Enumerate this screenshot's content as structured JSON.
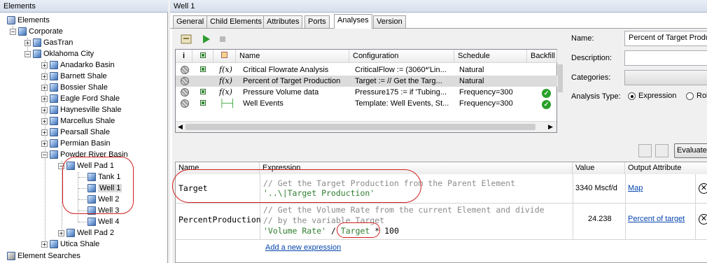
{
  "left": {
    "title": "Elements",
    "tree": [
      {
        "label": "Elements"
      },
      {
        "label": "Corporate"
      },
      {
        "label": "GasTran"
      },
      {
        "label": "Oklahoma City"
      },
      {
        "label": "Anadarko Basin"
      },
      {
        "label": "Barnett Shale"
      },
      {
        "label": "Bossier Shale"
      },
      {
        "label": "Eagle Ford Shale"
      },
      {
        "label": "Haynesville Shale"
      },
      {
        "label": "Marcellus Shale"
      },
      {
        "label": "Pearsall Shale"
      },
      {
        "label": "Permian Basin"
      },
      {
        "label": "Powder River Basin"
      },
      {
        "label": "Well Pad 1"
      },
      {
        "label": "Tank 1"
      },
      {
        "label": "Well 1"
      },
      {
        "label": "Well 2"
      },
      {
        "label": "Well 3"
      },
      {
        "label": "Well 4"
      },
      {
        "label": "Well Pad 2"
      },
      {
        "label": "Utica Shale"
      }
    ],
    "bottom": "Element Searches"
  },
  "right": {
    "title": "Well 1",
    "tabs": [
      "General",
      "Child Elements",
      "Attributes",
      "Ports",
      "Analyses",
      "Version"
    ],
    "active_tab": "Analyses",
    "grid": {
      "headers": [
        "Name",
        "Configuration",
        "Schedule",
        "Backfill"
      ],
      "rows": [
        {
          "name": "Critical Flowrate Analysis",
          "config": "CriticalFlow := (3060*'Lin...",
          "schedule": "Natural",
          "backfill": ""
        },
        {
          "name": "Percent of Target Production",
          "config": "Target := // Get the Targ...",
          "schedule": "Natural",
          "backfill": ""
        },
        {
          "name": "Pressure Volume data",
          "config": "Pressure175 := if 'Tubing...",
          "schedule": "Frequency=300",
          "backfill": "ok"
        },
        {
          "name": "Well Events",
          "config": "Template: Well Events, St...",
          "schedule": "Frequency=300",
          "backfill": "ok"
        }
      ]
    },
    "props": {
      "name_label": "Name:",
      "name_value": "Percent of Target Produc",
      "description_label": "Description:",
      "description_value": "",
      "categories_label": "Categories:",
      "analysis_type_label": "Analysis Type:",
      "opt_expression": "Expression",
      "opt_rollup": "Rol"
    },
    "evaluate_label": "Evaluate",
    "expr": {
      "headers": [
        "Name",
        "Expression",
        "Value",
        "Output Attribute"
      ],
      "rows": [
        {
          "name": "Target",
          "comment1": "// Get the Target Production from the Parent Element",
          "code1": "'..\\|Target Production'",
          "value": "3340 Mscf/d",
          "output": "Map"
        },
        {
          "name": "PercentProduction",
          "comment1": "// Get the Volume Rate from the current Element and divide",
          "comment2": "// by the variable Target",
          "code_a": "'Volume Rate'",
          "code_op": " / ",
          "code_b": "Target",
          "code_c": " * 100",
          "value": "24.238",
          "output": "Percent of target"
        }
      ],
      "add_link": "Add a new expression"
    }
  }
}
